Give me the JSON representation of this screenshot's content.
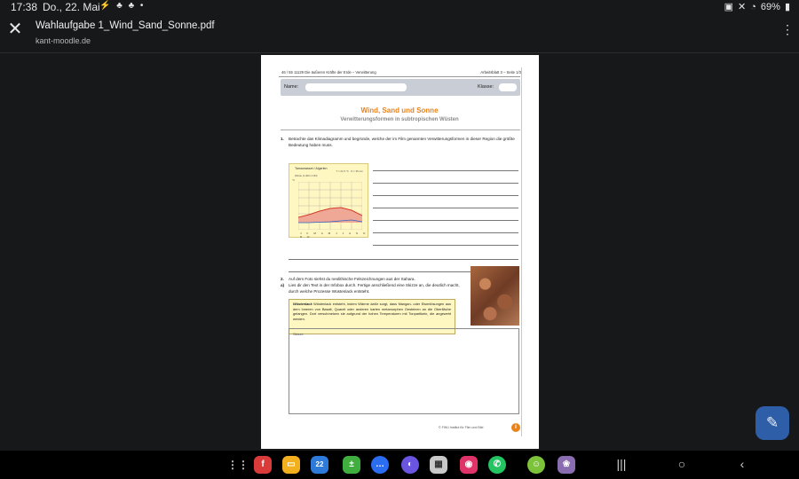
{
  "status_bar": {
    "time": "17:38",
    "date": "Do., 22. Mai",
    "battery": "69%"
  },
  "app_bar": {
    "title": "Wahlaufgabe 1_Wind_Sand_Sonne.pdf",
    "source": "kant-moodle.de"
  },
  "document": {
    "header_left": "46 / 55 11129 Die äußeren Kräfte der Erde – Verwitterung",
    "header_right": "Arbeitsblatt 3 – Seite 1/3",
    "name_label": "Name:",
    "class_label": "Klasse:",
    "title": "Wind, Sand und Sonne",
    "subtitle": "Verwitterungsformen in subtropischen Wüsten",
    "task1_num": "1.",
    "task1_text": "Betrachte das Klimadiagramm und begründe, welche der im Film genannten Verwitterungsformen in dieser Region die größte Bedeutung haben muss.",
    "chart_title": "Tamanrasset / Algerien",
    "chart_sub": "Wüste (1.400 m NN)",
    "chart_right": "T = 21,5 °C · N = 35 mm",
    "chart_unit": "°C",
    "chart_months": "J F M A M J J A S O N D",
    "task2_num": "2.",
    "task2_text": "Auf dem Foto siehst du neolithische Felszeichnungen aus der Sahara.",
    "task2a_num": "a)",
    "task2a_text": "Lies dir den Text in der Infobox durch. Fertige anschließend eine Skizze an, die deutlich macht, durch welche Prozesse Wüstenlack entsteht.",
    "info_term": "Wüstenlack",
    "info_text": "Wüstenlack entsteht, indem Wärme dafür sorgt, dass Mangan- oder Eisenlösungen aus dem Inneren von Basalt, Quarzit oder anderen harten metamorphen Gesteinen an die Oberfläche gelangen. Dort verschmelzen sie aufgrund der hohen Temperaturen mit Tonpartikeln, die angeweht werden.",
    "sketch_label": "Skizze",
    "footer": "© FWU Institut für Film und Bild"
  }
}
